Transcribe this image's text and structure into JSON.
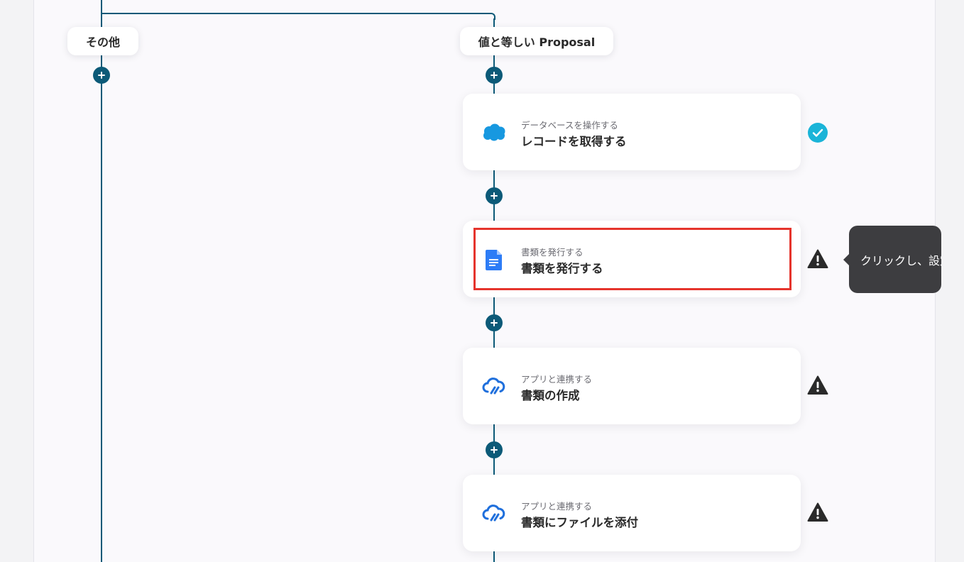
{
  "branches": {
    "other_label": "その他",
    "proposal_label": "値と等しい Proposal"
  },
  "cards": [
    {
      "sub": "データベースを操作する",
      "title": "レコードを取得する",
      "app_icon": "salesforce-cloud-icon",
      "status": "check-circle-icon"
    },
    {
      "sub": "書類を発行する",
      "title": "書類を発行する",
      "app_icon": "google-docs-icon",
      "status": "warning-icon",
      "highlighted": true
    },
    {
      "sub": "アプリと連携する",
      "title": "書類の作成",
      "app_icon": "cloud-sync-icon",
      "status": "warning-icon"
    },
    {
      "sub": "アプリと連携する",
      "title": "書類にファイルを添付",
      "app_icon": "cloud-sync-icon",
      "status": "warning-icon"
    }
  ],
  "tooltip": {
    "text": "クリックし、設定を完了してください"
  },
  "colors": {
    "connector": "#0c5a78",
    "highlight_border": "#e5342c",
    "check": "#1ab4d8",
    "warning": "#2a2a2a",
    "salesforce": "#1798e0",
    "docs": "#2d7cf6",
    "cloud_sync": "#1f6fdc"
  }
}
